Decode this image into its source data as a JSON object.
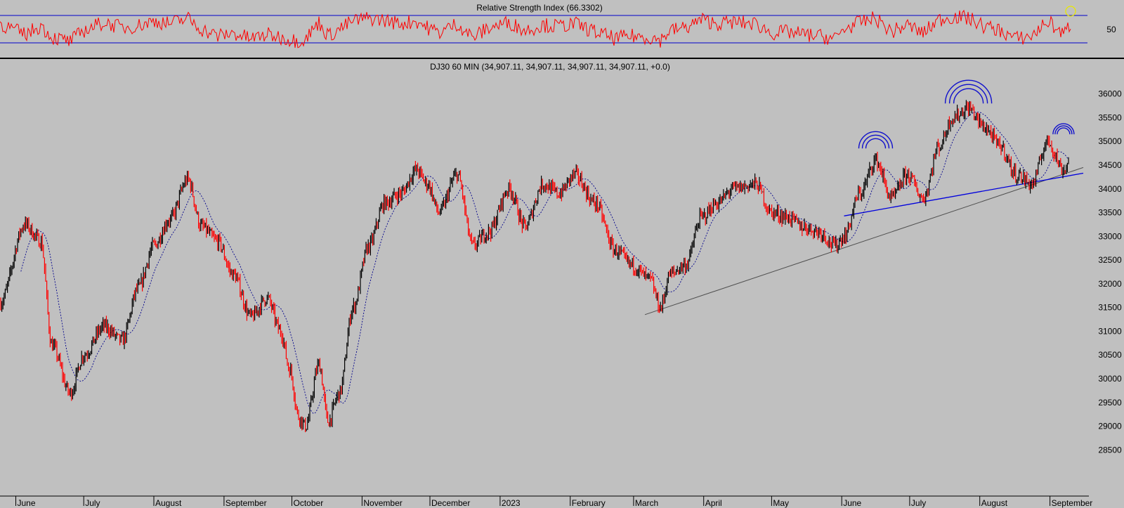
{
  "rsi_panel": {
    "title": "Relative Strength Index (66.3302)",
    "ticks": [
      50
    ],
    "upper_level": 70,
    "lower_level": 30,
    "value": 66.3302
  },
  "price_panel": {
    "title": "DJ30 60 MIN (34,907.11, 34,907.11, 34,907.11, 34,907.11, +0.0)",
    "y_ticks": [
      36000,
      35500,
      35000,
      34500,
      34000,
      33500,
      33000,
      32500,
      32000,
      31500,
      31000,
      30500,
      30000,
      29500,
      29000,
      28500
    ],
    "ylim": [
      28150,
      36350
    ]
  },
  "x_axis": {
    "labels": [
      "June",
      "July",
      "August",
      "September",
      "October",
      "November",
      "December",
      "2023",
      "February",
      "March",
      "April",
      "May",
      "June",
      "July",
      "August",
      "September"
    ]
  },
  "colors": {
    "background": "#c0c0c0",
    "up_bar": "#000000",
    "down_bar": "#ff0000",
    "rsi_line": "#ff0000",
    "rsi_levels": "#0000cc",
    "blue_trendline": "#0000dd",
    "gray_trendline": "#505050",
    "moving_average": "#00008b",
    "arc_markers": "#1010cc",
    "last_value_marker": "#e8e800"
  },
  "chart_data": {
    "type": "candlestick-line",
    "title": "DJ30 60 MIN (34,907.11, 34,907.11, 34,907.11, 34,907.11, +0.0)",
    "x": [
      "2022-05-25",
      "2022-06-05",
      "2022-06-12",
      "2022-06-17",
      "2022-06-25",
      "2022-07-01",
      "2022-07-10",
      "2022-07-18",
      "2022-07-25",
      "2022-08-01",
      "2022-08-08",
      "2022-08-16",
      "2022-08-22",
      "2022-08-29",
      "2022-09-05",
      "2022-09-13",
      "2022-09-20",
      "2022-09-26",
      "2022-09-30",
      "2022-10-04",
      "2022-10-07",
      "2022-10-13",
      "2022-10-17",
      "2022-10-22",
      "2022-10-28",
      "2022-11-04",
      "2022-11-11",
      "2022-11-18",
      "2022-11-25",
      "2022-11-30",
      "2022-12-05",
      "2022-12-13",
      "2022-12-20",
      "2022-12-27",
      "2023-01-05",
      "2023-01-12",
      "2023-01-20",
      "2023-01-27",
      "2023-02-03",
      "2023-02-12",
      "2023-02-21",
      "2023-02-28",
      "2023-03-08",
      "2023-03-13",
      "2023-03-17",
      "2023-03-24",
      "2023-03-31",
      "2023-04-07",
      "2023-04-14",
      "2023-04-24",
      "2023-05-01",
      "2023-05-08",
      "2023-05-15",
      "2023-05-22",
      "2023-05-29",
      "2023-06-02",
      "2023-06-09",
      "2023-06-16",
      "2023-06-23",
      "2023-06-30",
      "2023-07-07",
      "2023-07-14",
      "2023-07-20",
      "2023-07-27",
      "2023-08-03",
      "2023-08-10",
      "2023-08-17",
      "2023-08-24",
      "2023-08-31",
      "2023-09-07",
      "2023-09-12"
    ],
    "y": [
      31600,
      33250,
      32900,
      30700,
      29700,
      30500,
      31100,
      30800,
      31900,
      32800,
      33350,
      34200,
      33200,
      32900,
      32200,
      31300,
      31700,
      31000,
      30200,
      29200,
      29000,
      30300,
      29100,
      29700,
      31500,
      32800,
      33700,
      33900,
      34400,
      34100,
      33500,
      34300,
      32800,
      33100,
      34000,
      33200,
      34100,
      33900,
      34300,
      33700,
      32700,
      32400,
      32100,
      31500,
      32200,
      32400,
      33400,
      33700,
      34000,
      34100,
      33500,
      33400,
      33200,
      33100,
      32800,
      33000,
      33900,
      34600,
      33800,
      34300,
      33800,
      34900,
      35500,
      35700,
      35300,
      34900,
      34300,
      34100,
      35000,
      34400,
      34900
    ],
    "series": [
      {
        "name": "Relative Strength Index",
        "values": [
          58,
          42,
          55,
          38,
          32,
          48,
          60,
          52,
          55,
          62,
          58,
          66,
          50,
          40,
          44,
          36,
          42,
          38,
          35,
          33,
          36,
          60,
          40,
          50,
          62,
          66,
          63,
          58,
          62,
          52,
          45,
          58,
          38,
          52,
          60,
          48,
          56,
          54,
          58,
          46,
          36,
          40,
          38,
          34,
          48,
          52,
          64,
          58,
          60,
          58,
          44,
          46,
          42,
          40,
          36,
          50,
          60,
          66,
          46,
          56,
          44,
          64,
          68,
          66,
          54,
          48,
          36,
          40,
          62,
          42,
          66.3302
        ]
      }
    ],
    "ylim": [
      28150,
      36350
    ],
    "annotations": [
      "RSI levels 70 and 30",
      "rising trendline from March 2023 low",
      "rising trendline from June 2023",
      "triple arcs above June, July/August and September 2023 highs",
      "dotted moving average"
    ]
  }
}
